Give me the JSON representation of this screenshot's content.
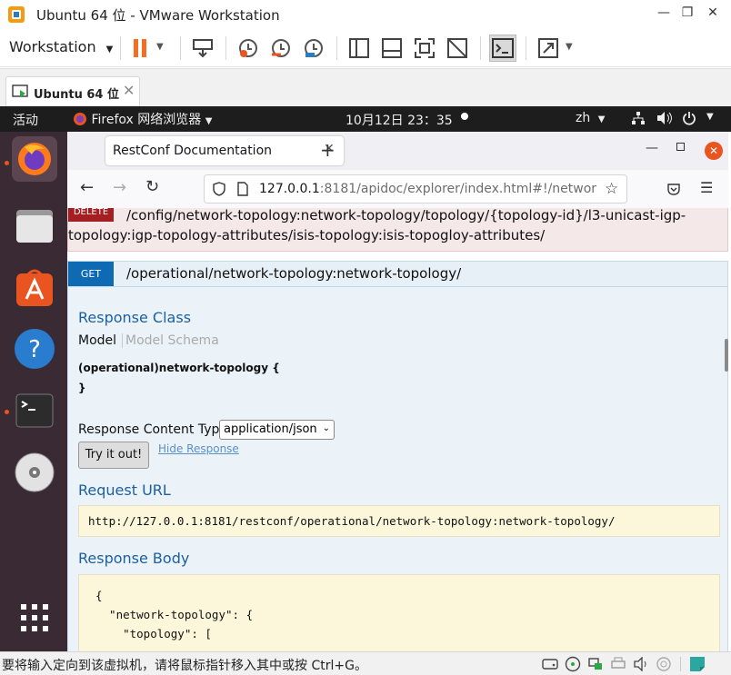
{
  "vmware": {
    "window_title": "Ubuntu 64 位 - VMware Workstation",
    "menu_label": "Workstation",
    "tab_label": "Ubuntu 64 位",
    "status_text": "要将输入定向到该虚拟机，请将鼠标指针移入其中或按 Ctrl+G。"
  },
  "ubuntu": {
    "activities": "活动",
    "app_name": "Firefox 网络浏览器",
    "clock": "10月12日  23：35",
    "lang": "zh"
  },
  "firefox": {
    "tab_title": "RestConf Documentation",
    "url_host": "127.0.0.1",
    "url_rest": ":8181/apidoc/explorer/index.html#!/networ"
  },
  "page": {
    "delete_badge": "DELETE",
    "delete_path": "/config/network-topology:network-topology/topology/{topology-id}/l3-unicast-igp-topology:igp-topology-attributes/isis-topology:isis-topogloy-attributes/",
    "get_badge": "GET",
    "get_path": "/operational/network-topology:network-topology/",
    "response_class": "Response Class",
    "model_tab": "Model",
    "model_schema_tab": "Model Schema",
    "model_name": "(operational)network-topology {",
    "model_close": "}",
    "content_type_label": "Response Content Type",
    "content_type_value": "application/json",
    "try_button": "Try it out!",
    "hide_response": "Hide Response",
    "request_url_title": "Request URL",
    "request_url": "http://127.0.0.1:8181/restconf/operational/network-topology:network-topology/",
    "response_body_title": "Response Body",
    "body_line1": "{",
    "body_line2": "  \"network-topology\": {",
    "body_line3": "    \"topology\": ["
  },
  "colors": {
    "accent_orange": "#e95420",
    "delete_red": "#a41e22",
    "get_blue": "#0f6ab4",
    "link_blue": "#1c5f9e"
  }
}
